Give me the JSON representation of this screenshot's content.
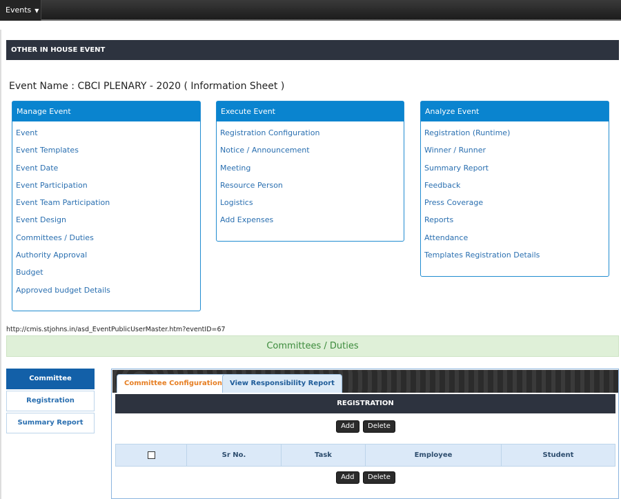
{
  "topbar": {
    "menu_label": "Events",
    "menu_caret": "▼"
  },
  "section": {
    "title": "OTHER IN HOUSE EVENT"
  },
  "event_name": "Event Name : CBCI PLENARY - 2020 ( Information Sheet )",
  "panels": {
    "manage": {
      "title": "Manage Event",
      "items": [
        "Event",
        "Event Templates",
        "Event Date",
        "Event Participation",
        "Event Team Participation",
        "Event Design",
        "Committees / Duties",
        "Authority Approval",
        "Budget",
        "Approved budget Details"
      ]
    },
    "execute": {
      "title": "Execute Event",
      "items": [
        "Registration Configuration",
        "Notice / Announcement",
        "Meeting",
        "Resource Person",
        "Logistics",
        "Add Expenses"
      ]
    },
    "analyze": {
      "title": "Analyze Event",
      "items": [
        "Registration (Runtime)",
        "Winner / Runner",
        "Summary Report",
        "Feedback",
        "Press Coverage",
        "Reports",
        "Attendance",
        "Templates Registration Details"
      ]
    }
  },
  "status_url": "http://cmis.stjohns.in/asd_EventPublicUserMaster.htm?eventID=67",
  "green_bar": "Committees / Duties",
  "side_nav": [
    "Committee",
    "Registration",
    "Summary Report"
  ],
  "tabs": [
    "Committee Configuration",
    "View Responsibility Report"
  ],
  "registration": {
    "title": "REGISTRATION",
    "add_label": "Add",
    "delete_label": "Delete",
    "columns": [
      "Sr No.",
      "Task",
      "Employee",
      "Student"
    ]
  }
}
